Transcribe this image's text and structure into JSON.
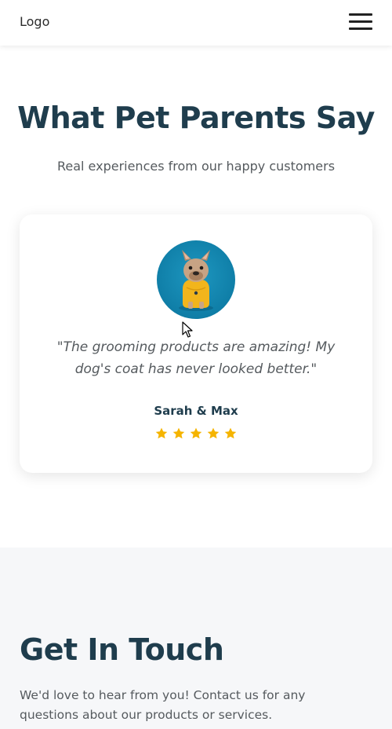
{
  "header": {
    "logo": "Logo",
    "menu_icon": "hamburger-menu-icon"
  },
  "testimonials": {
    "title": "What Pet Parents Say",
    "subtitle": "Real experiences from our happy customers",
    "card": {
      "avatar_alt": "french bulldog in yellow shirt",
      "quote": "\"The grooming products are amazing! My dog's coat has never looked better.\"",
      "author": "Sarah & Max",
      "rating": 5,
      "rating_max": 5,
      "star_color": "#f5b400"
    }
  },
  "contact": {
    "title": "Get In Touch",
    "text": "We'd love to hear from you! Contact us for any questions about our products or services."
  },
  "colors": {
    "heading": "#1f3d4d",
    "body_text": "#555a5e",
    "contact_bg": "#f6f7f9",
    "avatar_bg": "#0f7ea7"
  }
}
